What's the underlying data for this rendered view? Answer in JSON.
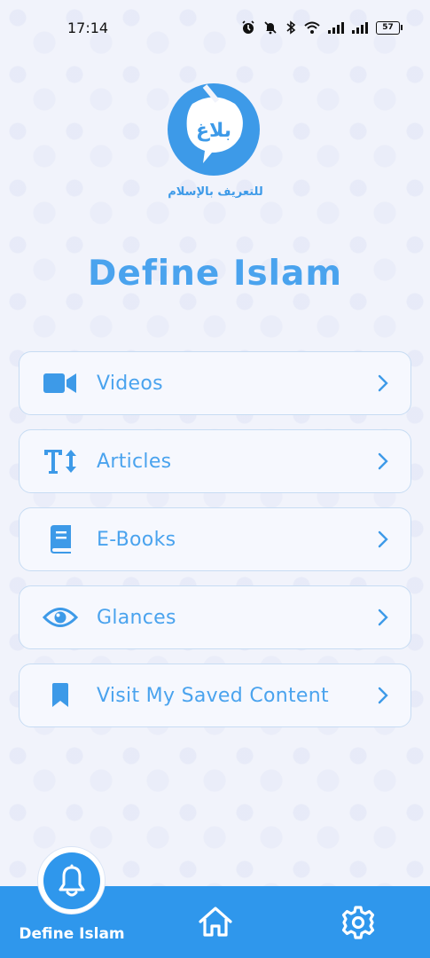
{
  "status_bar": {
    "time": "17:14",
    "battery": "57",
    "icons": [
      "alarm-icon",
      "mute-icon",
      "bluetooth-icon",
      "wifi-icon",
      "signal-icon",
      "signal-icon",
      "battery-icon"
    ]
  },
  "header": {
    "logo_name": "balagh-logo",
    "logo_text": "بلاغ",
    "logo_tagline": "للتعريف بالإسلام",
    "title": "Define Islam"
  },
  "menu": {
    "items": [
      {
        "label": "Videos",
        "icon": "video-camera-icon"
      },
      {
        "label": "Articles",
        "icon": "text-size-icon"
      },
      {
        "label": "E-Books",
        "icon": "book-icon"
      },
      {
        "label": "Glances",
        "icon": "eye-icon"
      },
      {
        "label": "Visit My Saved Content",
        "icon": "bookmark-icon"
      }
    ]
  },
  "bottom_nav": {
    "active_label": "Define Islam",
    "active_icon": "bell-icon",
    "items": [
      "home-icon",
      "gear-icon"
    ]
  },
  "colors": {
    "accent": "#4aa3ee",
    "nav_background": "#2f97ec",
    "page_background": "#f1f3fb",
    "card_border": "#c7dcf3"
  }
}
